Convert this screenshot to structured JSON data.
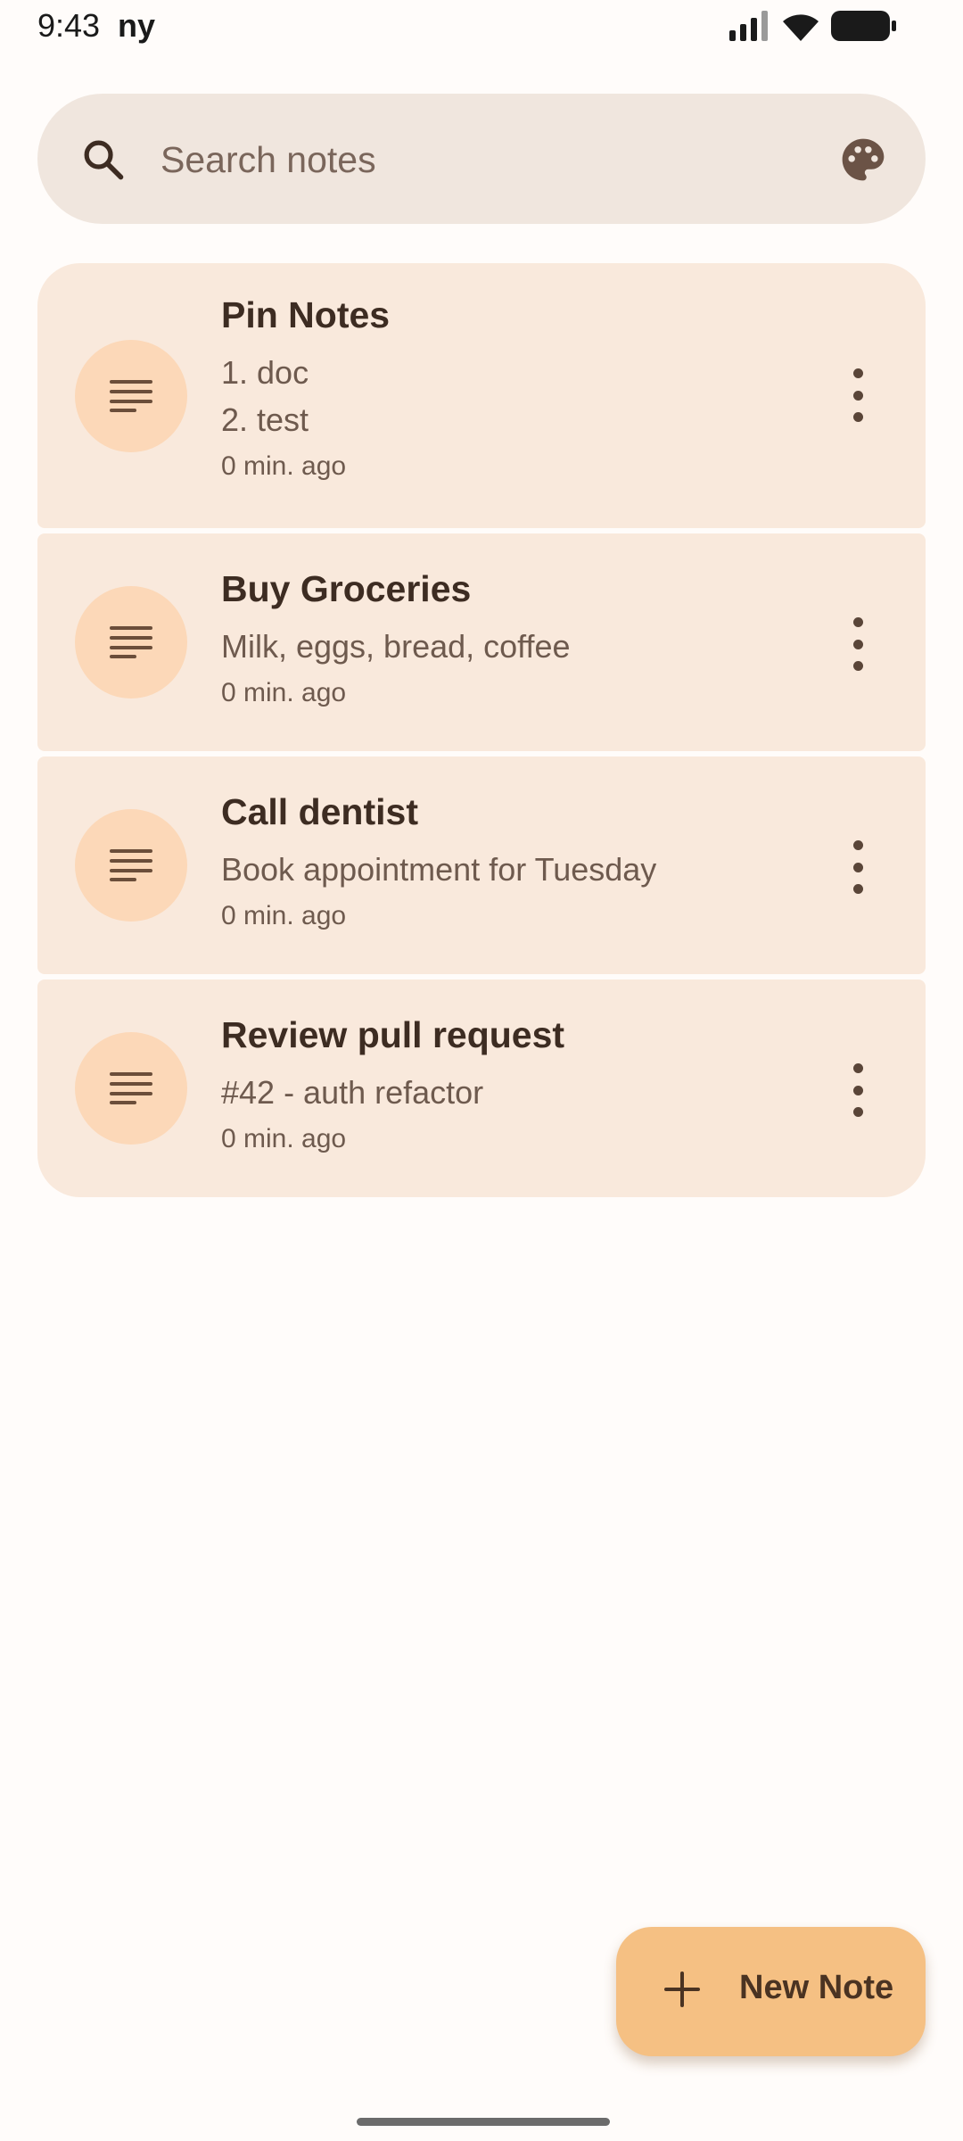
{
  "status_bar": {
    "time": "9:43",
    "carrier": "ny",
    "icons": [
      "signal-icon",
      "wifi-icon",
      "battery-icon"
    ]
  },
  "search": {
    "placeholder": "Search notes",
    "value": "",
    "leading_icon": "search-icon",
    "trailing_icon": "palette-icon"
  },
  "notes": [
    {
      "title": "Pin Notes",
      "body": "1. doc\n2. test",
      "time": "0 min. ago",
      "icon": "notes-lines-icon"
    },
    {
      "title": "Buy Groceries",
      "body": "Milk, eggs, bread, coffee",
      "time": "0 min. ago",
      "icon": "notes-lines-icon"
    },
    {
      "title": "Call dentist",
      "body": "Book appointment for Tuesday",
      "time": "0 min. ago",
      "icon": "notes-lines-icon"
    },
    {
      "title": "Review pull request",
      "body": "#42 - auth refactor",
      "time": "0 min. ago",
      "icon": "notes-lines-icon"
    }
  ],
  "fab": {
    "label": "New Note",
    "icon": "plus-icon"
  },
  "colors": {
    "background": "#fffcfa",
    "search_bg": "#f0e6de",
    "card_bg": "#f9e9dc",
    "avatar_bg": "#fcd8b8",
    "fab_bg": "#f5c083",
    "text_primary": "#3d2c22",
    "text_secondary": "#6e5a4e"
  }
}
